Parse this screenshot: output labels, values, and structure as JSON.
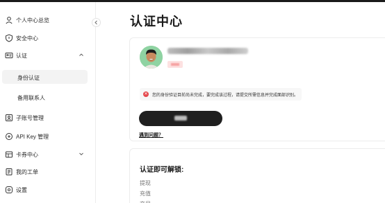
{
  "sidebar": {
    "items": [
      {
        "label": "个人中心总览",
        "icon": "user-icon"
      },
      {
        "label": "安全中心",
        "icon": "shield-icon"
      },
      {
        "label": "认证",
        "icon": "id-card-icon",
        "expanded": true,
        "children": [
          {
            "label": "身份认证",
            "active": true
          },
          {
            "label": "备用联系人",
            "active": false
          }
        ]
      },
      {
        "label": "子账号管理",
        "icon": "sub-account-icon"
      },
      {
        "label": "API Key 管理",
        "icon": "api-key-icon"
      },
      {
        "label": "卡券中心",
        "icon": "coupon-icon",
        "expanded": false
      },
      {
        "label": "我的工单",
        "icon": "ticket-icon"
      },
      {
        "label": "设置",
        "icon": "settings-icon"
      }
    ]
  },
  "main": {
    "title": "认证中心",
    "verification": {
      "alert_text": "您的身份验证目前尚未完成，要完成该过程，请提交所需信息并完成面部识别。",
      "help_link": "遇到问题？"
    },
    "unlock": {
      "title": "认证即可解锁:",
      "items": [
        "提现",
        "充值",
        "交易"
      ]
    }
  },
  "colors": {
    "topbar": "#1a1a1a",
    "primary_button": "#1f1f1f",
    "alert_icon": "#e5484d",
    "avatar_bg": "#8fd3a2"
  }
}
